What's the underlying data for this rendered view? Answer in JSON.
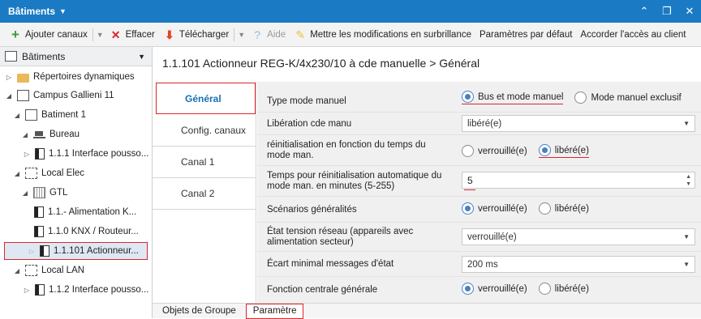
{
  "window": {
    "title": "Bâtiments"
  },
  "toolbar": {
    "add_label": "Ajouter canaux",
    "delete_label": "Effacer",
    "download_label": "Télécharger",
    "help_label": "Aide",
    "highlight_label": "Mettre les modifications en surbrillance",
    "defaults_label": "Paramètres par défaut",
    "access_label": "Accorder l'accès au client"
  },
  "sidebar": {
    "header": "Bâtiments",
    "nodes": [
      {
        "label": "Répertoires dynamiques"
      },
      {
        "label": "Campus Gallieni 11"
      },
      {
        "label": "Batiment 1"
      },
      {
        "label": "Bureau"
      },
      {
        "label": "1.1.1 Interface pousso..."
      },
      {
        "label": "Local Elec"
      },
      {
        "label": "GTL"
      },
      {
        "label": "1.1.- Alimentation K..."
      },
      {
        "label": "1.1.0 KNX / Routeur..."
      },
      {
        "label": "1.1.101 Actionneur..."
      },
      {
        "label": "Local LAN"
      },
      {
        "label": "1.1.2 Interface pousso..."
      }
    ]
  },
  "content": {
    "title": "1.1.101 Actionneur REG-K/4x230/10 à cde manuelle > Général",
    "tabs": [
      {
        "label": "Général"
      },
      {
        "label": "Config. canaux"
      },
      {
        "label": "Canal 1"
      },
      {
        "label": "Canal 2"
      }
    ],
    "params": {
      "mode": {
        "label": "Type mode manuel",
        "opt1": "Bus et mode manuel",
        "opt2": "Mode manuel exclusif"
      },
      "liberation": {
        "label": "Libération cde manu",
        "value": "libéré(e)"
      },
      "reinit": {
        "label": "réinitialisation en fonction du temps du mode man.",
        "opt1": "verrouillé(e)",
        "opt2": "libéré(e)"
      },
      "temps": {
        "label": "Temps pour réinitialisation automatique du mode man. en minutes (5-255)",
        "value": "5"
      },
      "scenarios": {
        "label": "Scénarios généralités",
        "opt1": "verrouillé(e)",
        "opt2": "libéré(e)"
      },
      "tension": {
        "label": "État tension réseau (appareils avec alimentation secteur)",
        "value": "verrouillé(e)"
      },
      "ecart": {
        "label": "Écart minimal messages d'état",
        "value": "200 ms"
      },
      "centrale": {
        "label": "Fonction centrale générale",
        "opt1": "verrouillé(e)",
        "opt2": "libéré(e)"
      }
    },
    "bottom_tabs": {
      "group_objects": "Objets de Groupe",
      "parameter": "Paramètre"
    }
  }
}
